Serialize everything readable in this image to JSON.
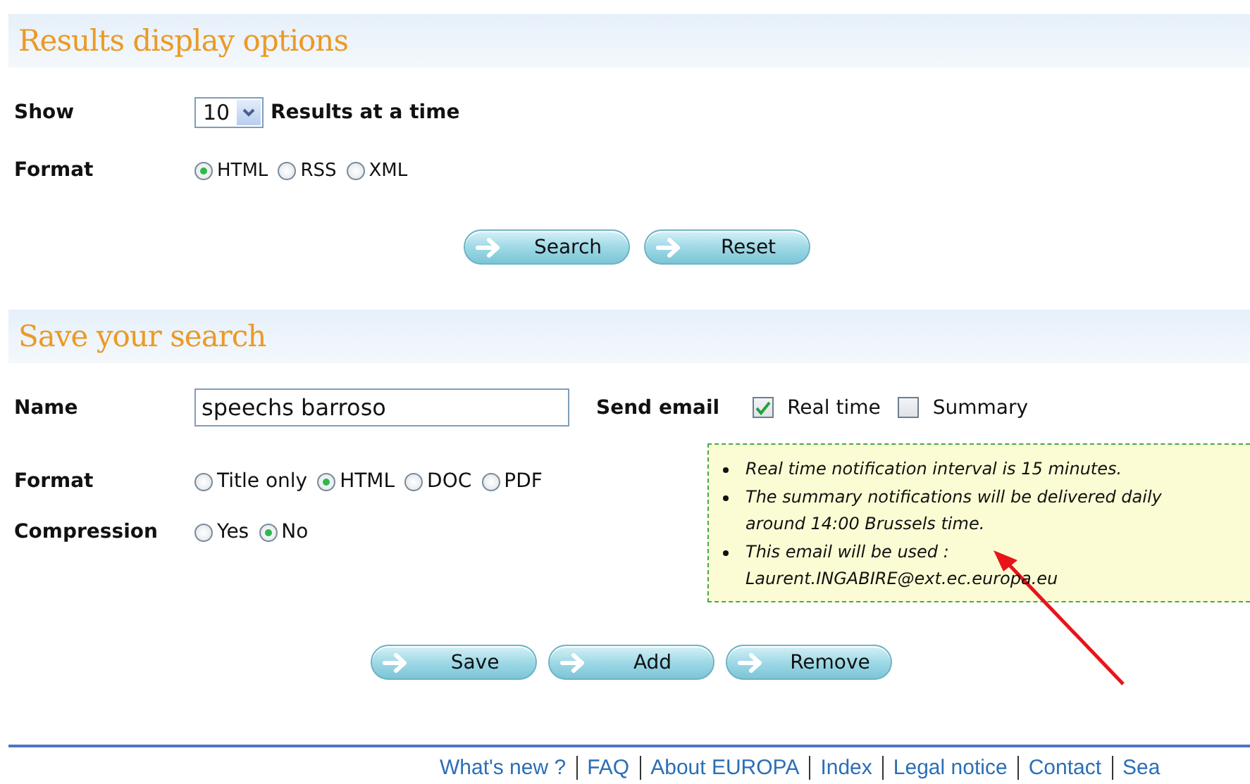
{
  "results_options": {
    "title": "Results display options",
    "show": {
      "label": "Show",
      "value": "10",
      "suffix": "Results at a time"
    },
    "format": {
      "label": "Format",
      "options": [
        {
          "label": "HTML",
          "selected": true
        },
        {
          "label": "RSS",
          "selected": false
        },
        {
          "label": "XML",
          "selected": false
        }
      ]
    },
    "buttons": [
      "Search",
      "Reset"
    ]
  },
  "save_search": {
    "title": "Save your search",
    "name": {
      "label": "Name",
      "value": "speechs barroso"
    },
    "send_email": {
      "label": "Send email",
      "options": [
        {
          "label": "Real time",
          "checked": true
        },
        {
          "label": "Summary",
          "checked": false
        }
      ]
    },
    "format": {
      "label": "Format",
      "options": [
        {
          "label": "Title only",
          "selected": false
        },
        {
          "label": "HTML",
          "selected": true
        },
        {
          "label": "DOC",
          "selected": false
        },
        {
          "label": "PDF",
          "selected": false
        }
      ]
    },
    "compression": {
      "label": "Compression",
      "options": [
        {
          "label": "Yes",
          "selected": false
        },
        {
          "label": "No",
          "selected": true
        }
      ]
    },
    "notes": [
      "Real time notification interval is 15 minutes.",
      "The summary notifications will be delivered daily around 14:00 Brussels time.",
      "This email will be used : Laurent.INGABIRE@ext.ec.europa.eu"
    ],
    "buttons": [
      "Save",
      "Add",
      "Remove"
    ]
  },
  "footer": {
    "links": [
      "What's new ?",
      "FAQ",
      "About EUROPA",
      "Index",
      "Legal notice",
      "Contact",
      "Sea"
    ]
  }
}
